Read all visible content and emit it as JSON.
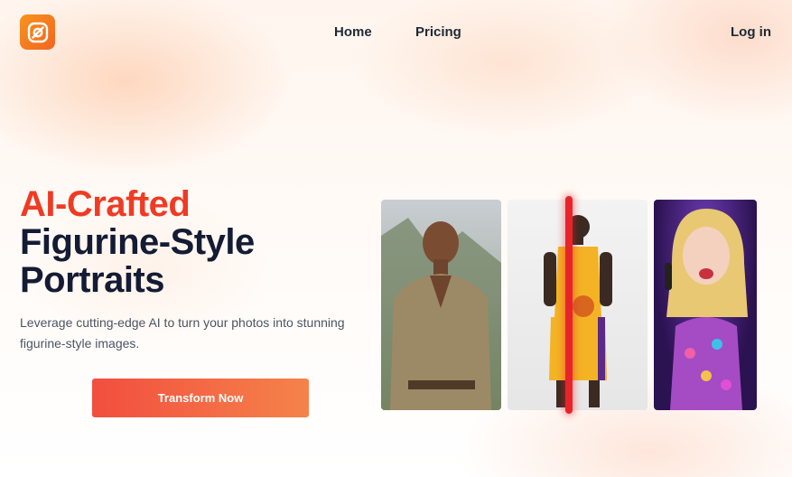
{
  "nav": {
    "home": "Home",
    "pricing": "Pricing",
    "login": "Log in"
  },
  "hero": {
    "title_accent": "AI-Crafted",
    "title_line2": "Figurine-Style",
    "title_line3": "Portraits",
    "subtitle": "Leverage cutting-edge AI to turn your photos into stunning figurine-style images.",
    "cta": "Transform Now"
  },
  "colors": {
    "accent": "#ef3b24",
    "brand_orange": "#f26522",
    "heading": "#141b34",
    "divider": "#e8242b"
  },
  "icons": {
    "logo": "brand-logo-icon",
    "gallery": [
      "photo-before-man",
      "figurine-basketball-player",
      "figurine-singer"
    ]
  }
}
